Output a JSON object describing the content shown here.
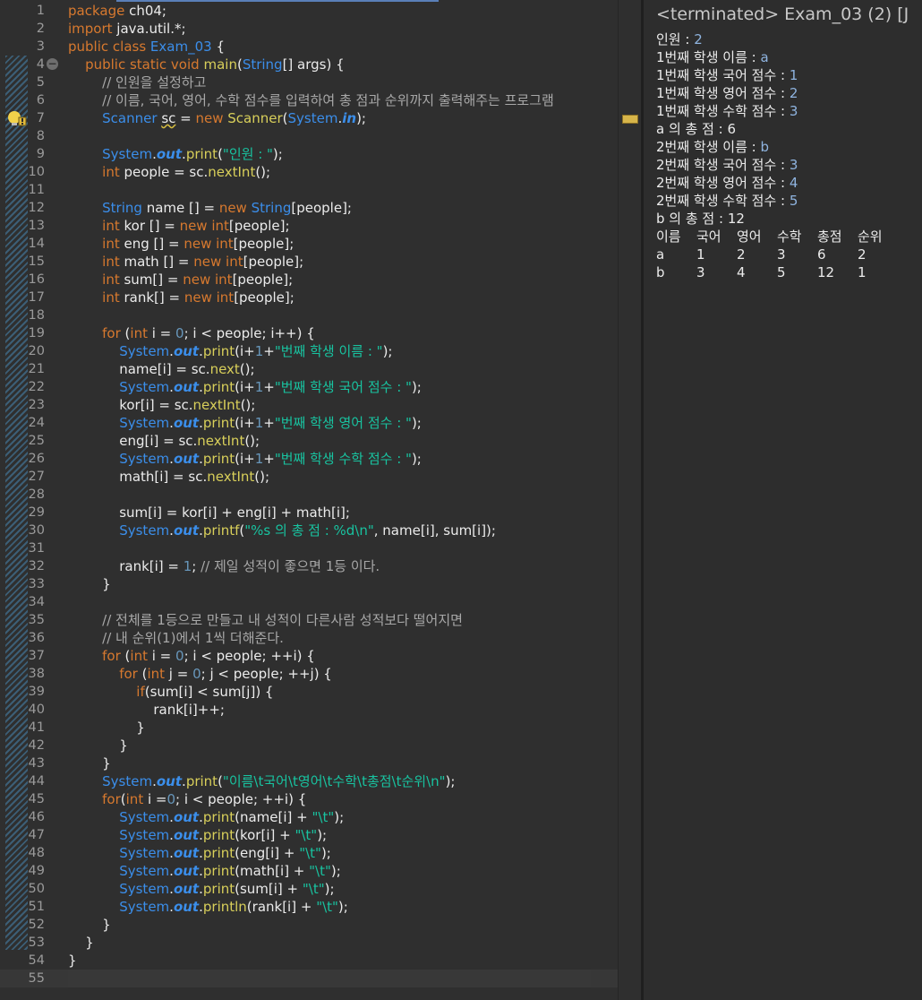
{
  "editor": {
    "lines": [
      {
        "n": "1",
        "html": "<span class=\"kw\">package</span> ch04;"
      },
      {
        "n": "2",
        "html": "<span class=\"kw\">import</span> java.util.*;"
      },
      {
        "n": "3",
        "html": "<span class=\"kw\">public class</span> <span class=\"ty\">Exam_03</span> {"
      },
      {
        "n": "4",
        "fold": true,
        "html": "    <span class=\"kw\">public static void</span> <span class=\"fn\">main</span>(<span class=\"ty\">String</span>[] args) {"
      },
      {
        "n": "5",
        "html": "        <span class=\"cm\">// 인원을 설정하고</span>"
      },
      {
        "n": "6",
        "html": "        <span class=\"cm\">// 이름, 국어, 영어, 수학 점수를 입력하여 총 점과 순위까지 출력해주는 프로그램</span>"
      },
      {
        "n": "7",
        "warn": true,
        "html": "        <span class=\"ty\">Scanner</span> <span class=\"uv\">sc</span> = <span class=\"kw\">new</span> <span class=\"fn\">Scanner</span>(<span class=\"ty\">System</span>.<span class=\"ci\">in</span>);"
      },
      {
        "n": "8",
        "html": ""
      },
      {
        "n": "9",
        "html": "        <span class=\"ty\">System</span>.<span class=\"ci\">out</span>.<span class=\"fn\">print</span>(<span class=\"st\">\"인원 : \"</span>);"
      },
      {
        "n": "10",
        "html": "        <span class=\"kw\">int</span> people = sc.<span class=\"fn\">nextInt</span>();"
      },
      {
        "n": "11",
        "html": ""
      },
      {
        "n": "12",
        "html": "        <span class=\"ty\">String</span> name [] = <span class=\"kw\">new</span> <span class=\"ty\">String</span>[people];"
      },
      {
        "n": "13",
        "html": "        <span class=\"kw\">int</span> kor [] = <span class=\"kw\">new int</span>[people];"
      },
      {
        "n": "14",
        "html": "        <span class=\"kw\">int</span> eng [] = <span class=\"kw\">new int</span>[people];"
      },
      {
        "n": "15",
        "html": "        <span class=\"kw\">int</span> math [] = <span class=\"kw\">new int</span>[people];"
      },
      {
        "n": "16",
        "html": "        <span class=\"kw\">int</span> sum[] = <span class=\"kw\">new int</span>[people];"
      },
      {
        "n": "17",
        "html": "        <span class=\"kw\">int</span> rank[] = <span class=\"kw\">new int</span>[people];"
      },
      {
        "n": "18",
        "html": ""
      },
      {
        "n": "19",
        "html": "        <span class=\"kw\">for</span> (<span class=\"kw\">int</span> i = <span class=\"nm\">0</span>; i &lt; people; i++) {"
      },
      {
        "n": "20",
        "html": "            <span class=\"ty\">System</span>.<span class=\"ci\">out</span>.<span class=\"fn\">print</span>(i+<span class=\"nm\">1</span>+<span class=\"st\">\"번째 학생 이름 : \"</span>);"
      },
      {
        "n": "21",
        "html": "            name[i] = sc.<span class=\"fn\">next</span>();"
      },
      {
        "n": "22",
        "html": "            <span class=\"ty\">System</span>.<span class=\"ci\">out</span>.<span class=\"fn\">print</span>(i+<span class=\"nm\">1</span>+<span class=\"st\">\"번째 학생 국어 점수 : \"</span>);"
      },
      {
        "n": "23",
        "html": "            kor[i] = sc.<span class=\"fn\">nextInt</span>();"
      },
      {
        "n": "24",
        "html": "            <span class=\"ty\">System</span>.<span class=\"ci\">out</span>.<span class=\"fn\">print</span>(i+<span class=\"nm\">1</span>+<span class=\"st\">\"번째 학생 영어 점수 : \"</span>);"
      },
      {
        "n": "25",
        "html": "            eng[i] = sc.<span class=\"fn\">nextInt</span>();"
      },
      {
        "n": "26",
        "html": "            <span class=\"ty\">System</span>.<span class=\"ci\">out</span>.<span class=\"fn\">print</span>(i+<span class=\"nm\">1</span>+<span class=\"st\">\"번째 학생 수학 점수 : \"</span>);"
      },
      {
        "n": "27",
        "html": "            math[i] = sc.<span class=\"fn\">nextInt</span>();"
      },
      {
        "n": "28",
        "html": ""
      },
      {
        "n": "29",
        "html": "            sum[i] = kor[i] + eng[i] + math[i];"
      },
      {
        "n": "30",
        "html": "            <span class=\"ty\">System</span>.<span class=\"ci\">out</span>.<span class=\"fn\">printf</span>(<span class=\"st\">\"%s 의 총 점 : %d\\n\"</span>, name[i], sum[i]);"
      },
      {
        "n": "31",
        "html": ""
      },
      {
        "n": "32",
        "html": "            rank[i] = <span class=\"nm\">1</span>; <span class=\"cm\">// 제일 성적이 좋으면 1등 이다.</span>"
      },
      {
        "n": "33",
        "html": "        }"
      },
      {
        "n": "34",
        "html": ""
      },
      {
        "n": "35",
        "html": "        <span class=\"cm\">// 전체를 1등으로 만들고 내 성적이 다른사람 성적보다 떨어지면</span>"
      },
      {
        "n": "36",
        "html": "        <span class=\"cm\">// 내 순위(1)에서 1씩 더해준다.</span>"
      },
      {
        "n": "37",
        "html": "        <span class=\"kw\">for</span> (<span class=\"kw\">int</span> i = <span class=\"nm\">0</span>; i &lt; people; ++i) {"
      },
      {
        "n": "38",
        "html": "            <span class=\"kw\">for</span> (<span class=\"kw\">int</span> j = <span class=\"nm\">0</span>; j &lt; people; ++j) {"
      },
      {
        "n": "39",
        "html": "                <span class=\"kw\">if</span>(sum[i] &lt; sum[j]) {"
      },
      {
        "n": "40",
        "html": "                    rank[i]++;"
      },
      {
        "n": "41",
        "html": "                }"
      },
      {
        "n": "42",
        "html": "            }"
      },
      {
        "n": "43",
        "html": "        }"
      },
      {
        "n": "44",
        "html": "        <span class=\"ty\">System</span>.<span class=\"ci\">out</span>.<span class=\"fn\">print</span>(<span class=\"st\">\"이름\\t국어\\t영어\\t수학\\t총점\\t순위\\n\"</span>);"
      },
      {
        "n": "45",
        "html": "        <span class=\"kw\">for</span>(<span class=\"kw\">int</span> i =<span class=\"nm\">0</span>; i &lt; people; ++i) {"
      },
      {
        "n": "46",
        "html": "            <span class=\"ty\">System</span>.<span class=\"ci\">out</span>.<span class=\"fn\">print</span>(name[i] + <span class=\"st\">\"\\t\"</span>);"
      },
      {
        "n": "47",
        "html": "            <span class=\"ty\">System</span>.<span class=\"ci\">out</span>.<span class=\"fn\">print</span>(kor[i] + <span class=\"st\">\"\\t\"</span>);"
      },
      {
        "n": "48",
        "html": "            <span class=\"ty\">System</span>.<span class=\"ci\">out</span>.<span class=\"fn\">print</span>(eng[i] + <span class=\"st\">\"\\t\"</span>);"
      },
      {
        "n": "49",
        "html": "            <span class=\"ty\">System</span>.<span class=\"ci\">out</span>.<span class=\"fn\">print</span>(math[i] + <span class=\"st\">\"\\t\"</span>);"
      },
      {
        "n": "50",
        "html": "            <span class=\"ty\">System</span>.<span class=\"ci\">out</span>.<span class=\"fn\">print</span>(sum[i] + <span class=\"st\">\"\\t\"</span>);"
      },
      {
        "n": "51",
        "html": "            <span class=\"ty\">System</span>.<span class=\"ci\">out</span>.<span class=\"fn\">println</span>(rank[i] + <span class=\"st\">\"\\t\"</span>);"
      },
      {
        "n": "52",
        "html": "        }"
      },
      {
        "n": "53",
        "html": "    }"
      },
      {
        "n": "54",
        "html": "}"
      },
      {
        "n": "55",
        "html": "",
        "current": true
      }
    ]
  },
  "console": {
    "title": "<terminated> Exam_03 (2) [J",
    "lines": [
      {
        "prompt": "인원 : ",
        "input": "2"
      },
      {
        "prompt": "1번째 학생 이름 : ",
        "input": "a"
      },
      {
        "prompt": "1번째 학생 국어 점수 : ",
        "input": "1"
      },
      {
        "prompt": "1번째 학생 영어 점수 : ",
        "input": "2"
      },
      {
        "prompt": "1번째 학생 수학 점수 : ",
        "input": "3"
      },
      {
        "prompt": "a 의 총 점 : 6",
        "input": ""
      },
      {
        "prompt": "2번째 학생 이름 : ",
        "input": "b"
      },
      {
        "prompt": "2번째 학생 국어 점수 : ",
        "input": "3"
      },
      {
        "prompt": "2번째 학생 영어 점수 : ",
        "input": "4"
      },
      {
        "prompt": "2번째 학생 수학 점수 : ",
        "input": "5"
      },
      {
        "prompt": "b 의 총 점 : 12",
        "input": ""
      }
    ],
    "table": [
      [
        "이름",
        "국어",
        "영어",
        "수학",
        "총점",
        "순위"
      ],
      [
        "a",
        "1",
        "2",
        "3",
        "6",
        "2"
      ],
      [
        "b",
        "3",
        "4",
        "5",
        "12",
        "1"
      ]
    ]
  },
  "colors": {
    "keyword": "#d7792f",
    "type": "#3b8eea",
    "string": "#18c3a0",
    "number": "#6897bb",
    "comment": "#a8a8a8",
    "method": "#d8cf5a",
    "console_input": "#8fb4e0"
  },
  "icons": {
    "fold": "collapse-circle-icon",
    "warning": "warning-lightbulb-icon",
    "overview": "warning-overview-marker-icon"
  }
}
